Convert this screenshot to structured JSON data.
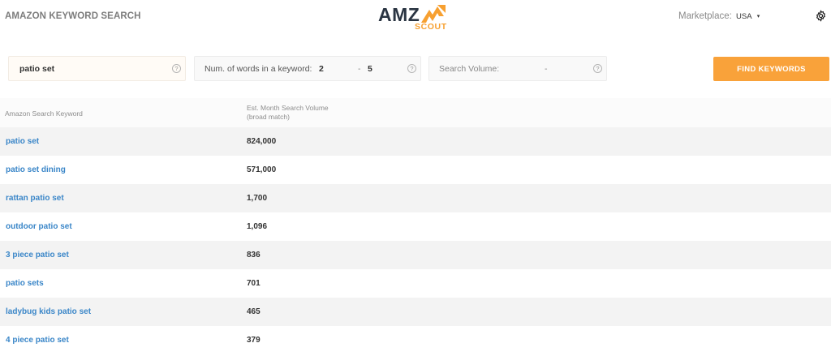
{
  "header": {
    "app_title": "AMAZON KEYWORD SEARCH",
    "logo_amz": "AMZ",
    "logo_scout": "SCOUT",
    "marketplace_label": "Marketplace:",
    "marketplace_value": "USA",
    "marketplace_caret": "▾"
  },
  "search": {
    "keyword_value": "patio set",
    "words_label": "Num. of words in a keyword:",
    "words_min": "2",
    "words_sep": "-",
    "words_max": "5",
    "volume_label": "Search Volume:",
    "volume_value": "-",
    "help_glyph": "?",
    "find_button": "FIND KEYWORDS"
  },
  "table": {
    "col_keyword": "Amazon Search Keyword",
    "col_volume_line1": "Est. Month Search Volume",
    "col_volume_line2": "(broad match)",
    "rows": [
      {
        "keyword": "patio set",
        "volume": "824,000"
      },
      {
        "keyword": "patio set dining",
        "volume": "571,000"
      },
      {
        "keyword": "rattan patio set",
        "volume": "1,700"
      },
      {
        "keyword": "outdoor patio set",
        "volume": "1,096"
      },
      {
        "keyword": "3 piece patio set",
        "volume": "836"
      },
      {
        "keyword": "patio sets",
        "volume": "701"
      },
      {
        "keyword": "ladybug kids patio set",
        "volume": "465"
      },
      {
        "keyword": "4 piece patio set",
        "volume": "379"
      }
    ]
  },
  "colors": {
    "accent": "#f9a23a",
    "link": "#3a86c8",
    "logo_dark": "#2a3442"
  },
  "icons": {
    "settings": "gear-icon",
    "help": "help-icon",
    "logo_arrow": "arrow-up-icon"
  }
}
